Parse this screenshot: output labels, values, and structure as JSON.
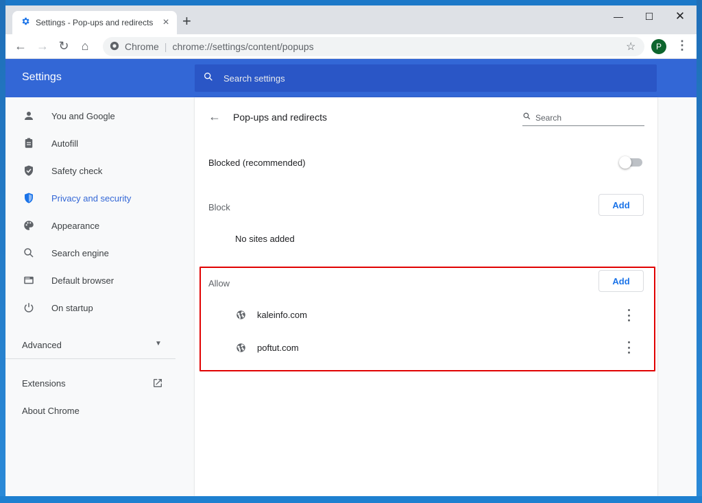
{
  "browser": {
    "tab_title": "Settings - Pop-ups and redirects",
    "omnibox_label": "Chrome",
    "url": "chrome://settings/content/popups",
    "profile_initial": "P"
  },
  "settings": {
    "title": "Settings",
    "search_placeholder": "Search settings"
  },
  "sidebar": {
    "items": [
      {
        "label": "You and Google",
        "icon": "person-icon"
      },
      {
        "label": "Autofill",
        "icon": "clipboard-icon"
      },
      {
        "label": "Safety check",
        "icon": "shield-check-icon"
      },
      {
        "label": "Privacy and security",
        "icon": "shield-icon",
        "active": true
      },
      {
        "label": "Appearance",
        "icon": "palette-icon"
      },
      {
        "label": "Search engine",
        "icon": "search-icon"
      },
      {
        "label": "Default browser",
        "icon": "browser-icon"
      },
      {
        "label": "On startup",
        "icon": "power-icon"
      }
    ],
    "advanced": "Advanced",
    "extensions": "Extensions",
    "about": "About Chrome"
  },
  "page": {
    "title": "Pop-ups and redirects",
    "search_placeholder": "Search",
    "blocked_label": "Blocked (recommended)",
    "blocked_toggle_on": false,
    "block_section": {
      "title": "Block",
      "add_label": "Add",
      "empty_text": "No sites added"
    },
    "allow_section": {
      "title": "Allow",
      "add_label": "Add",
      "sites": [
        "kaleinfo.com",
        "poftut.com"
      ]
    }
  },
  "colors": {
    "header_blue": "#3367d6",
    "accent": "#1a73e8",
    "highlight_red": "#e00000"
  }
}
